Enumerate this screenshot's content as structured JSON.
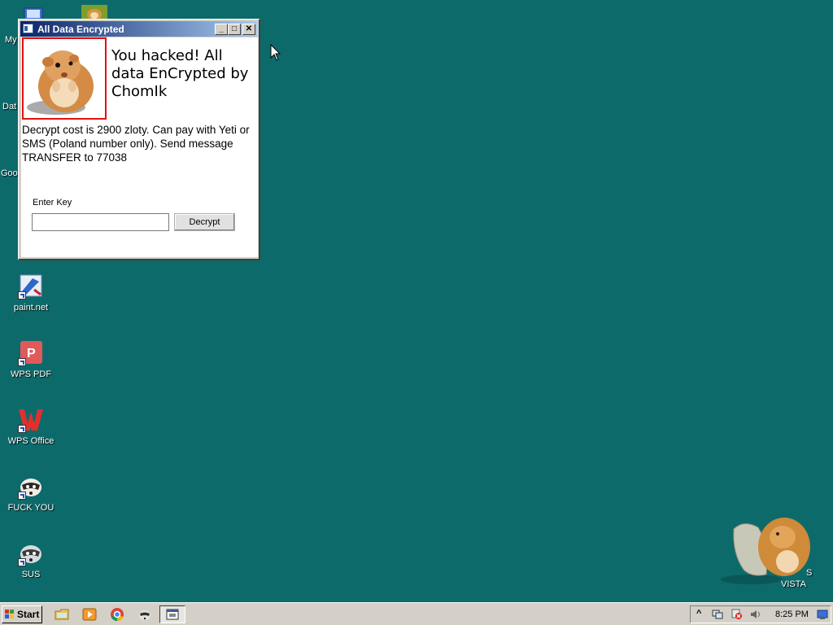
{
  "desktop": {
    "icons": [
      {
        "label": "paint.net"
      },
      {
        "label": "WPS PDF"
      },
      {
        "label": "WPS Office"
      },
      {
        "label": "FUCK YOU"
      },
      {
        "label": "SUS"
      }
    ],
    "partial_labels": [
      "My",
      "Dat",
      "Goo"
    ],
    "corner_overlay_text": [
      "S",
      "VISTA"
    ]
  },
  "window": {
    "title": "All Data Encrypted",
    "headline": "You hacked! All data EnCrypted by ChomIk",
    "message": "Decrypt cost is 2900 zloty. Can pay with Yeti or SMS (Poland number only). Send message TRANSFER to 77038",
    "key_label": "Enter Key",
    "key_value": "",
    "decrypt_label": "Decrypt",
    "controls": {
      "minimize": "_",
      "maximize": "□",
      "close": "✕"
    }
  },
  "taskbar": {
    "start_label": "Start",
    "clock": "8:25 PM",
    "tray_expand": "^"
  },
  "colors": {
    "desktop": "#0d6a6a",
    "title_gradient_start": "#0a246a",
    "title_gradient_end": "#a6caf0",
    "image_border": "#e11010"
  }
}
